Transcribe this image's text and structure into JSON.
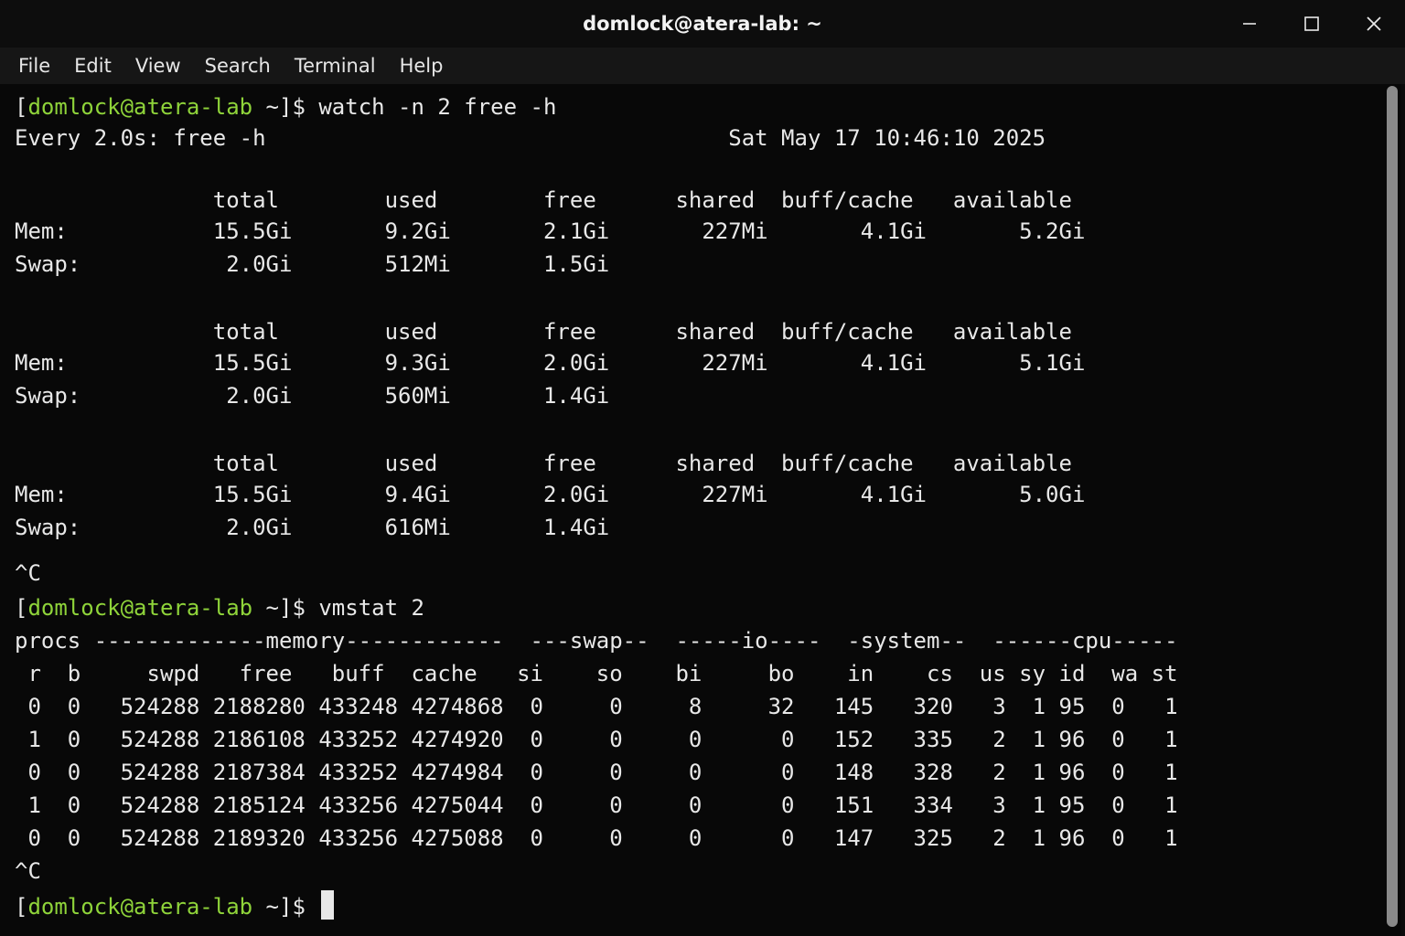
{
  "window": {
    "title": "domlock@atera-lab: ~",
    "controls": {
      "minimize_icon": "minimize-icon",
      "maximize_icon": "maximize-icon",
      "close_icon": "close-icon"
    }
  },
  "menu": [
    "File",
    "Edit",
    "View",
    "Search",
    "Terminal",
    "Help"
  ],
  "prompt": {
    "open": "[",
    "user_host": "domlock@atera-lab",
    "close": " ~]$ "
  },
  "lines": [
    {
      "type": "prompt",
      "cmd": "watch -n 2 free -h"
    },
    {
      "type": "text",
      "text": "Every 2.0s: free -h                                   Sat May 17 10:46:10 2025"
    },
    {
      "type": "text",
      "text": "               total        used        free      shared  buff/cache   available"
    },
    {
      "type": "text",
      "text": "Mem:           15.5Gi       9.2Gi       2.1Gi       227Mi       4.1Gi       5.2Gi"
    },
    {
      "type": "text",
      "text": "Swap:           2.0Gi       512Mi       1.5Gi"
    },
    {
      "type": "text",
      "text": "               total        used        free      shared  buff/cache   available"
    },
    {
      "type": "text",
      "text": "Mem:           15.5Gi       9.3Gi       2.0Gi       227Mi       4.1Gi       5.1Gi"
    },
    {
      "type": "text",
      "text": "Swap:           2.0Gi       560Mi       1.4Gi"
    },
    {
      "type": "text",
      "text": "               total        used        free      shared  buff/cache   available"
    },
    {
      "type": "text",
      "text": "Mem:           15.5Gi       9.4Gi       2.0Gi       227Mi       4.1Gi       5.0Gi"
    },
    {
      "type": "text",
      "text": "Swap:           2.0Gi       616Mi       1.4Gi"
    },
    {
      "type": "text",
      "text": "^C"
    },
    {
      "type": "prompt",
      "cmd": "vmstat 2"
    },
    {
      "type": "text",
      "text": "procs -------------memory------------  ---swap--  -----io----  -system--  ------cpu-----"
    },
    {
      "type": "text",
      "text": " r  b     swpd   free   buff  cache   si    so    bi     bo    in    cs  us sy id  wa st"
    },
    {
      "type": "text",
      "text": " 0  0   524288 2188280 433248 4274868  0     0     8     32   145   320   3  1 95  0   1"
    },
    {
      "type": "text",
      "text": " 1  0   524288 2186108 433252 4274920  0     0     0      0   152   335   2  1 96  0   1"
    },
    {
      "type": "text",
      "text": " 0  0   524288 2187384 433252 4274984  0     0     0      0   148   328   2  1 96  0   1"
    },
    {
      "type": "text",
      "text": " 1  0   524288 2185124 433256 4275044  0     0     0      0   151   334   3  1 95  0   1"
    },
    {
      "type": "text",
      "text": " 0  0   524288 2189320 433256 4275088  0     0     0      0   147   325   2  1 96  0   1"
    },
    {
      "type": "text",
      "text": "^C"
    },
    {
      "type": "prompt",
      "cmd": "",
      "cursor": true
    }
  ]
}
